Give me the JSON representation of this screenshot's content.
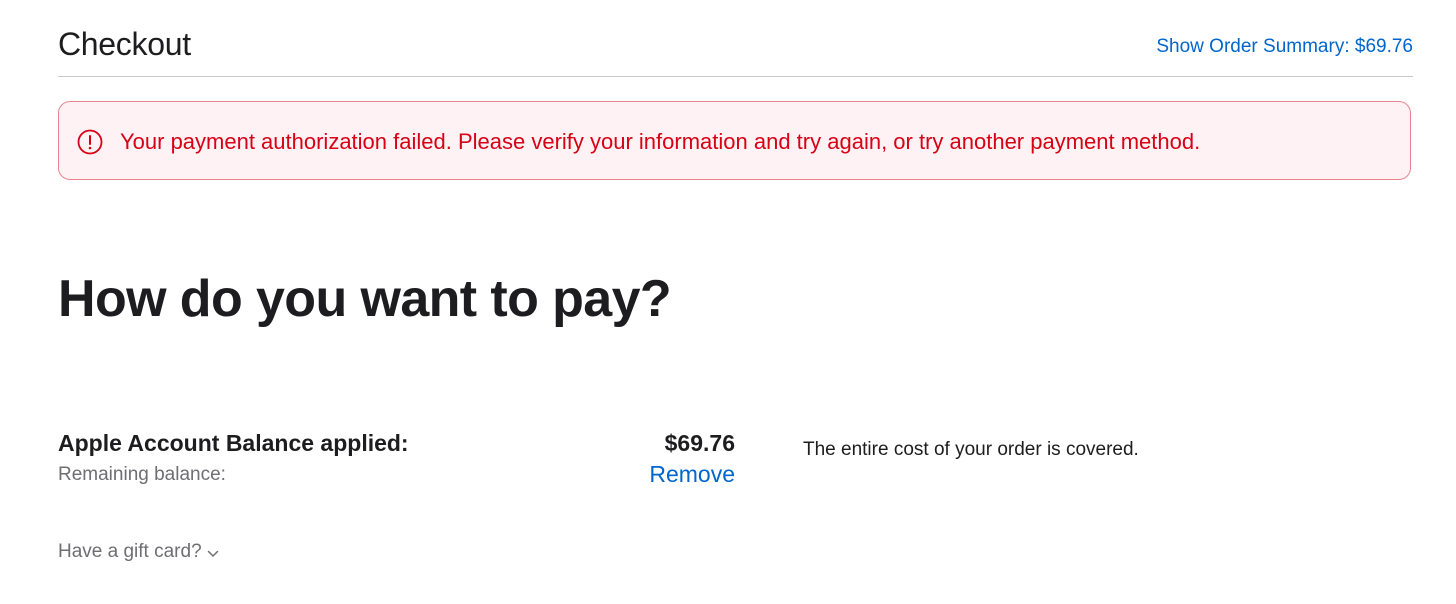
{
  "header": {
    "title": "Checkout",
    "order_summary_link": "Show Order Summary: $69.76"
  },
  "alert": {
    "icon": "exclamation-circle-icon",
    "message": "Your payment authorization failed. Please verify your information and try again, or try another payment method.",
    "color": "#d70015",
    "background": "#fff2f4",
    "border": "#e9848f"
  },
  "payment": {
    "heading": "How do you want to pay?",
    "balance_label": "Apple Account Balance applied:",
    "balance_amount": "$69.76",
    "remaining_label": "Remaining balance:",
    "remove_label": "Remove",
    "covered_note": "The entire cost of your order is covered.",
    "gift_card_label": "Have a gift card?",
    "gift_card_icon": "chevron-down-icon"
  },
  "colors": {
    "link": "#0066cc",
    "text": "#1d1d1f",
    "secondary_text": "#6e6e73"
  }
}
